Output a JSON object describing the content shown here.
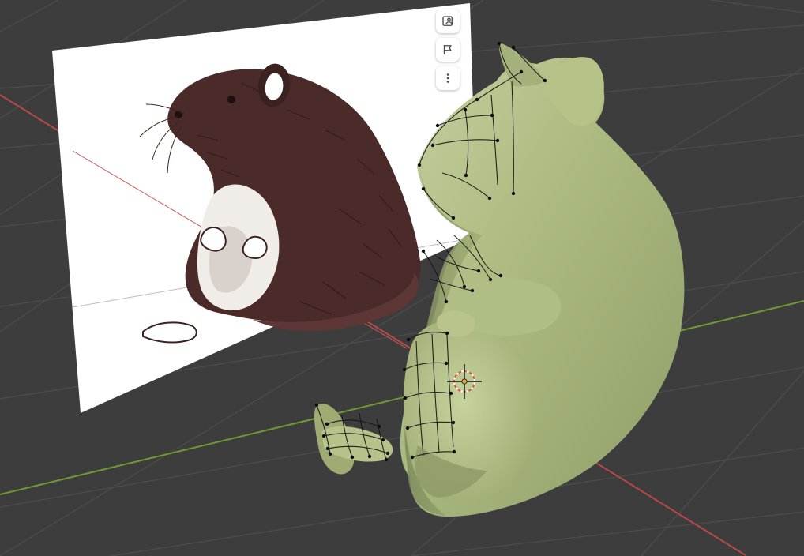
{
  "viewport": {
    "background": "#3d3d3d",
    "grid_color": "#4b4b4b",
    "x_axis_color": "#b64848",
    "y_axis_color": "#6f9a32"
  },
  "reference_image": {
    "frame_color": "#ffffff",
    "subject": "rat-sketch"
  },
  "mesh": {
    "color": "#aab97f",
    "shadow": "#7f8d5e",
    "highlight": "#c3cf98",
    "wire_color": "#151515"
  },
  "origin_marker": {
    "ring_colors": [
      "#ffffff",
      "#d35a3a"
    ]
  },
  "overlay_toolbar": {
    "buttons": [
      {
        "icon": "image-person-icon"
      },
      {
        "icon": "flag-icon"
      },
      {
        "icon": "more-vertical-icon"
      }
    ]
  }
}
